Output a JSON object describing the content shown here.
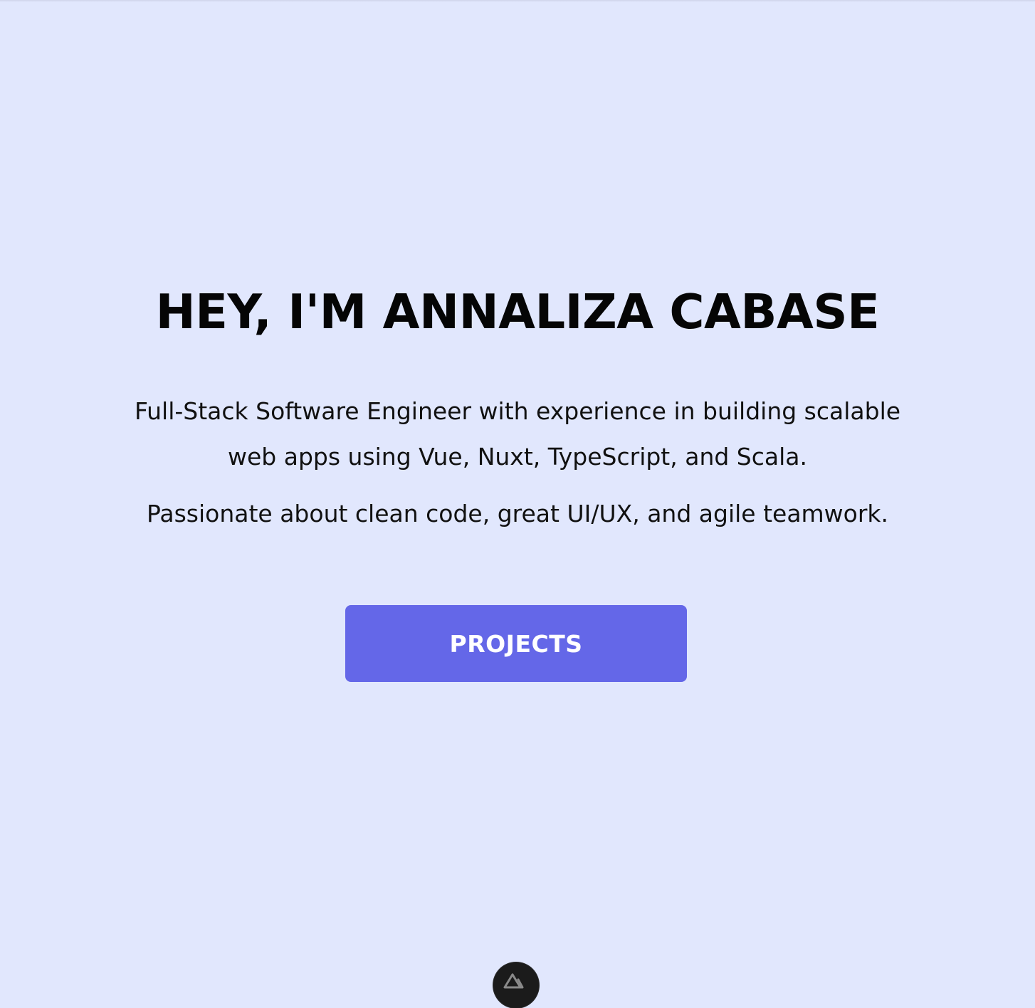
{
  "hero": {
    "title": "HEY, I'M ANNALIZA CABASE",
    "intro": "Full-Stack Software Engineer with experience in building scalable web apps using Vue, Nuxt, TypeScript, and Scala.",
    "tagline": "Passionate about clean code, great UI/UX, and agile teamwork.",
    "cta_label": "PROJECTS"
  },
  "devtools": {
    "icon": "nuxt-logo-icon"
  },
  "colors": {
    "background": "#e1e7fd",
    "accent": "#6467e8",
    "text": "#050505",
    "devtools_bg": "#1b1b1b"
  }
}
